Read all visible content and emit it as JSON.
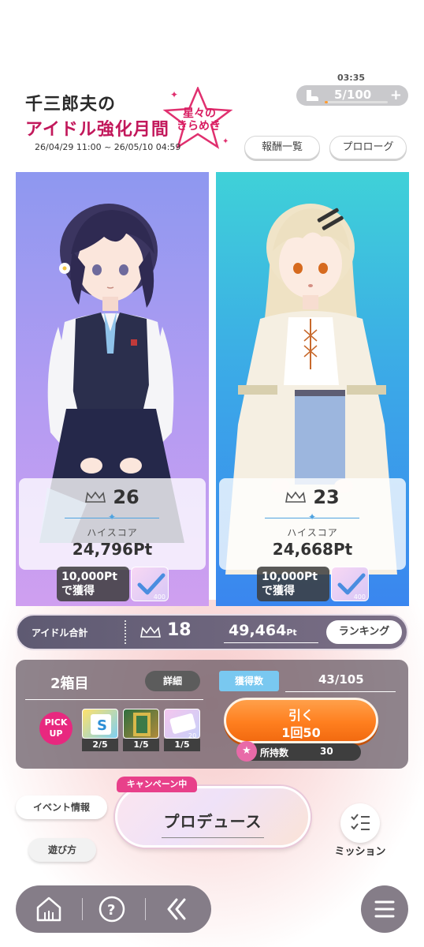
{
  "header": {
    "title_line1": "千三郎夫の",
    "title_line2": "アイドル強化月間",
    "title_badge_line1": "星々の",
    "title_badge_line2": "きらめき",
    "period": "26/04/29 11:00 ~ 26/05/10 04:59"
  },
  "stamina": {
    "timer": "03:35",
    "value": "5/100",
    "fill_fraction": 0.05,
    "plus": "+"
  },
  "buttons": {
    "rewards": "報酬一覧",
    "prologue": "プロローグ"
  },
  "cards": [
    {
      "rank": "26",
      "score_label": "ハイスコア",
      "score": "24,796Pt",
      "reward_line1": "10,000Pt",
      "reward_line2": "で獲得",
      "reward_count": "400"
    },
    {
      "rank": "23",
      "score_label": "ハイスコア",
      "score": "24,668Pt",
      "reward_line1": "10,000Pt",
      "reward_line2": "で獲得",
      "reward_count": "400"
    }
  ],
  "total": {
    "label": "アイドル合計",
    "rank": "18",
    "points": "49,464",
    "points_unit": "Pt",
    "ranking_button": "ランキング"
  },
  "box": {
    "title": "2箱目",
    "detail_button": "詳細",
    "acquired_label": "獲得数",
    "acquired_value": "43/105",
    "pickup_line1": "PICK",
    "pickup_line2": "UP",
    "items": [
      {
        "count": "2/5",
        "badge": ""
      },
      {
        "count": "1/5",
        "badge": ""
      },
      {
        "count": "1/5",
        "badge": "20"
      }
    ],
    "draw_label": "引く",
    "draw_sub": "1回50",
    "owned_label": "所持数",
    "owned_value": "30"
  },
  "produce": {
    "campaign": "キャンペーン中",
    "label": "プロデュース",
    "event_info": "イベント情報",
    "how_to": "遊び方",
    "mission": "ミッション"
  },
  "nav": {
    "items": [
      "home-icon",
      "help-icon",
      "back-icon",
      "menu-icon"
    ]
  },
  "colors": {
    "accent": "#e8287f",
    "draw_orange": "#ff7f1f",
    "card_left": "#a59cf2",
    "card_right": "#3ba7e8"
  }
}
